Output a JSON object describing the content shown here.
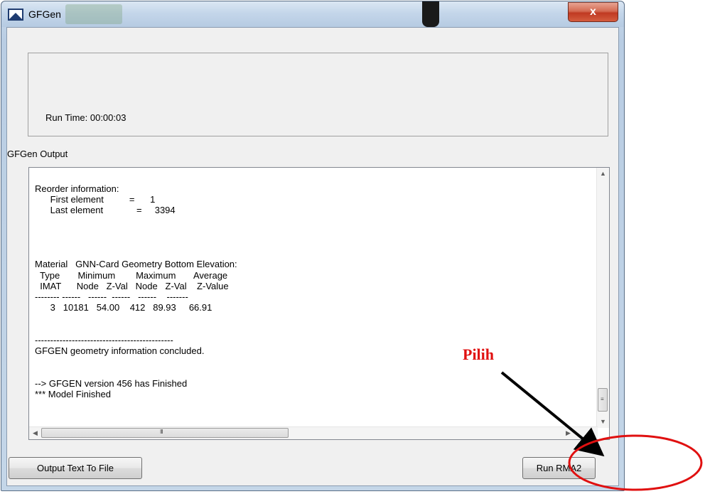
{
  "window": {
    "title": "GFGen",
    "close_label": "x"
  },
  "status": {
    "run_time": "Run Time: 00:00:03"
  },
  "output": {
    "label": "GFGen Output",
    "text": "Reorder information:\n      First element          =      1\n      Last element             =     3394\n\n\n\n\nMaterial   GNN-Card Geometry Bottom Elevation:\n  Type       Minimum        Maximum       Average\n  IMAT      Node   Z-Val   Node   Z-Val    Z-Value\n-------- ------   ------  ------   ------    -------\n      3   10181   54.00    412   89.93     66.91\n\n\n---------------------------------------------\nGFGEN geometry information concluded.\n\n\n--> GFGEN version 456 has Finished\n*** Model Finished"
  },
  "buttons": {
    "output_text_to_file": "Output Text To File",
    "run_rma2": "Run RMA2"
  },
  "annotation": {
    "label": "Pilih",
    "color": "#e01010"
  },
  "icons": {
    "app": "gfgen-app-icon",
    "close": "close-icon",
    "scroll_up": "chevron-up-icon",
    "scroll_down": "chevron-down-icon",
    "scroll_left": "chevron-left-icon",
    "scroll_right": "chevron-right-icon"
  }
}
